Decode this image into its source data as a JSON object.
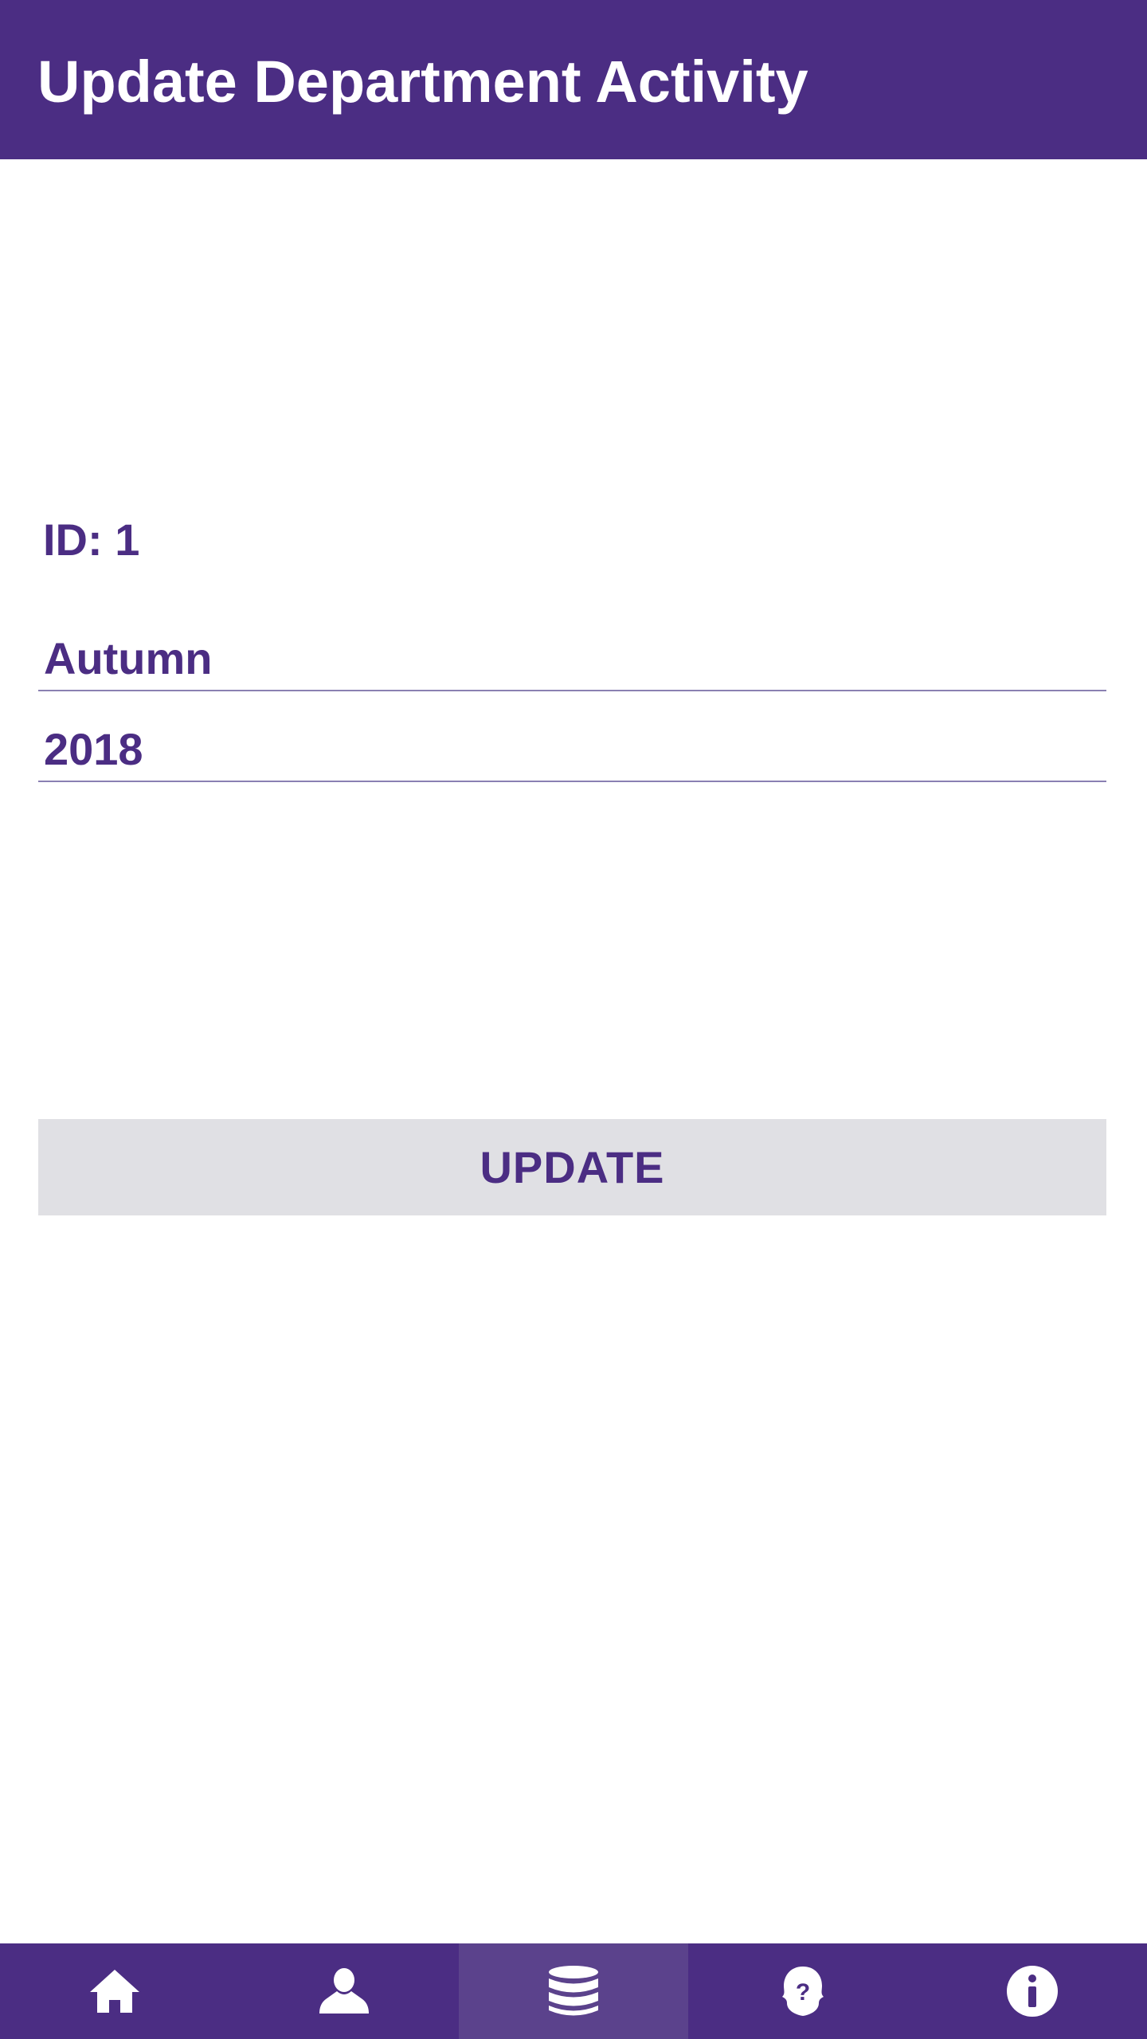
{
  "header": {
    "title": "Update Department Activity"
  },
  "form": {
    "id_label": "ID: 1",
    "season_value": "Autumn",
    "year_value": "2018",
    "update_label": "UPDATE"
  },
  "navbar": {
    "items": [
      {
        "icon": "home-icon",
        "active": false
      },
      {
        "icon": "user-icon",
        "active": false
      },
      {
        "icon": "database-icon",
        "active": true
      },
      {
        "icon": "help-icon",
        "active": false
      },
      {
        "icon": "info-icon",
        "active": false
      }
    ]
  },
  "colors": {
    "primary": "#4b2d83",
    "nav_active": "#5b428c",
    "button_bg": "#e0e0e4",
    "text_on_primary": "#ffffff"
  }
}
